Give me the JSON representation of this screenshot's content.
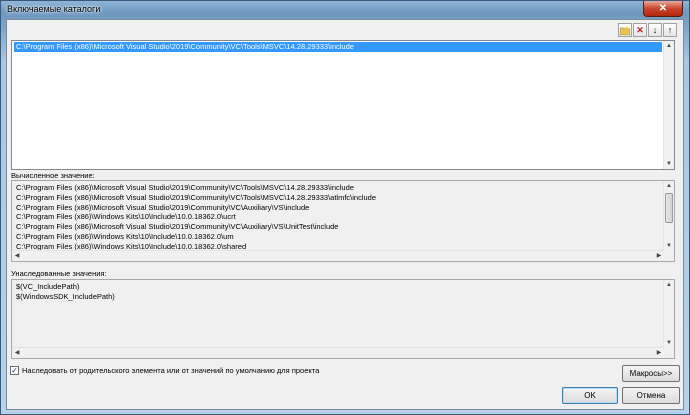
{
  "window": {
    "title": "Включаемые каталоги",
    "close_glyph": "✕"
  },
  "toolbar": {
    "icons": [
      "new-folder-icon",
      "delete-icon",
      "move-down-icon",
      "move-up-icon"
    ],
    "delete_glyph": "✕",
    "down_glyph": "↓",
    "up_glyph": "↑"
  },
  "edit_list": {
    "items": [
      "C:\\Program Files (x86)\\Microsoft Visual Studio\\2019\\Community\\VC\\Tools\\MSVC\\14.28.29333\\include"
    ]
  },
  "evaluated": {
    "label": "Вычисленное значение:",
    "lines": [
      "C:\\Program Files (x86)\\Microsoft Visual Studio\\2019\\Community\\VC\\Tools\\MSVC\\14.28.29333\\include",
      "C:\\Program Files (x86)\\Microsoft Visual Studio\\2019\\Community\\VC\\Tools\\MSVC\\14.28.29333\\atlmfc\\include",
      "C:\\Program Files (x86)\\Microsoft Visual Studio\\2019\\Community\\VC\\Auxiliary\\VS\\include",
      "C:\\Program Files (x86)\\Windows Kits\\10\\Include\\10.0.18362.0\\ucrt",
      "C:\\Program Files (x86)\\Microsoft Visual Studio\\2019\\Community\\VC\\Auxiliary\\VS\\UnitTest\\include",
      "C:\\Program Files (x86)\\Windows Kits\\10\\Include\\10.0.18362.0\\um",
      "C:\\Program Files (x86)\\Windows Kits\\10\\Include\\10.0.18362.0\\shared"
    ]
  },
  "inherited": {
    "label": "Унаследованные значения:",
    "lines": [
      "$(VC_IncludePath)",
      "$(WindowsSDK_IncludePath)"
    ]
  },
  "inherit_checkbox": {
    "label": "Наследовать от родительского элемента или от значений по умолчанию для проекта",
    "checked": true,
    "check_glyph": "✓"
  },
  "buttons": {
    "macros": "Макросы>>",
    "ok": "OK",
    "cancel": "Отмена"
  },
  "colors": {
    "selection": "#3399ff",
    "title_bar": "#8fb5d8",
    "close": "#c7462d"
  }
}
